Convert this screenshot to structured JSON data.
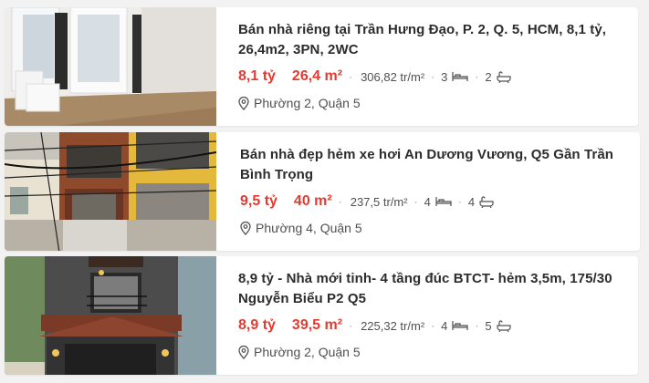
{
  "listings": [
    {
      "title": "Bán nhà riêng tại Trần Hưng Đạo, P. 2, Q. 5, HCM, 8,1 tỷ, 26,4m2, 3PN, 2WC",
      "price": "8,1 tỷ",
      "area": "26,4 m²",
      "price_per_m2": "306,82 tr/m²",
      "bedrooms": "3",
      "bathrooms": "2",
      "location": "Phường 2, Quận 5"
    },
    {
      "title": "Bán nhà đẹp hẻm xe hơi An Dương Vương, Q5 Gần Trần Bình Trọng",
      "price": "9,5 tỷ",
      "area": "40 m²",
      "price_per_m2": "237,5 tr/m²",
      "bedrooms": "4",
      "bathrooms": "4",
      "location": "Phường 4, Quận 5"
    },
    {
      "title": "8,9 tỷ - Nhà mới tinh- 4 tầng đúc BTCT- hẻm 3,5m, 175/30 Nguyễn Biểu P2 Q5",
      "price": "8,9 tỷ",
      "area": "39,5 m²",
      "price_per_m2": "225,32 tr/m²",
      "bedrooms": "4",
      "bathrooms": "5",
      "location": "Phường 2, Quận 5"
    }
  ],
  "icons": {
    "bed": "bed-icon",
    "bath": "bathtub-icon",
    "location": "location-pin-icon"
  },
  "colors": {
    "price": "#e03c31",
    "text": "#2c2c2c",
    "muted": "#505050"
  }
}
